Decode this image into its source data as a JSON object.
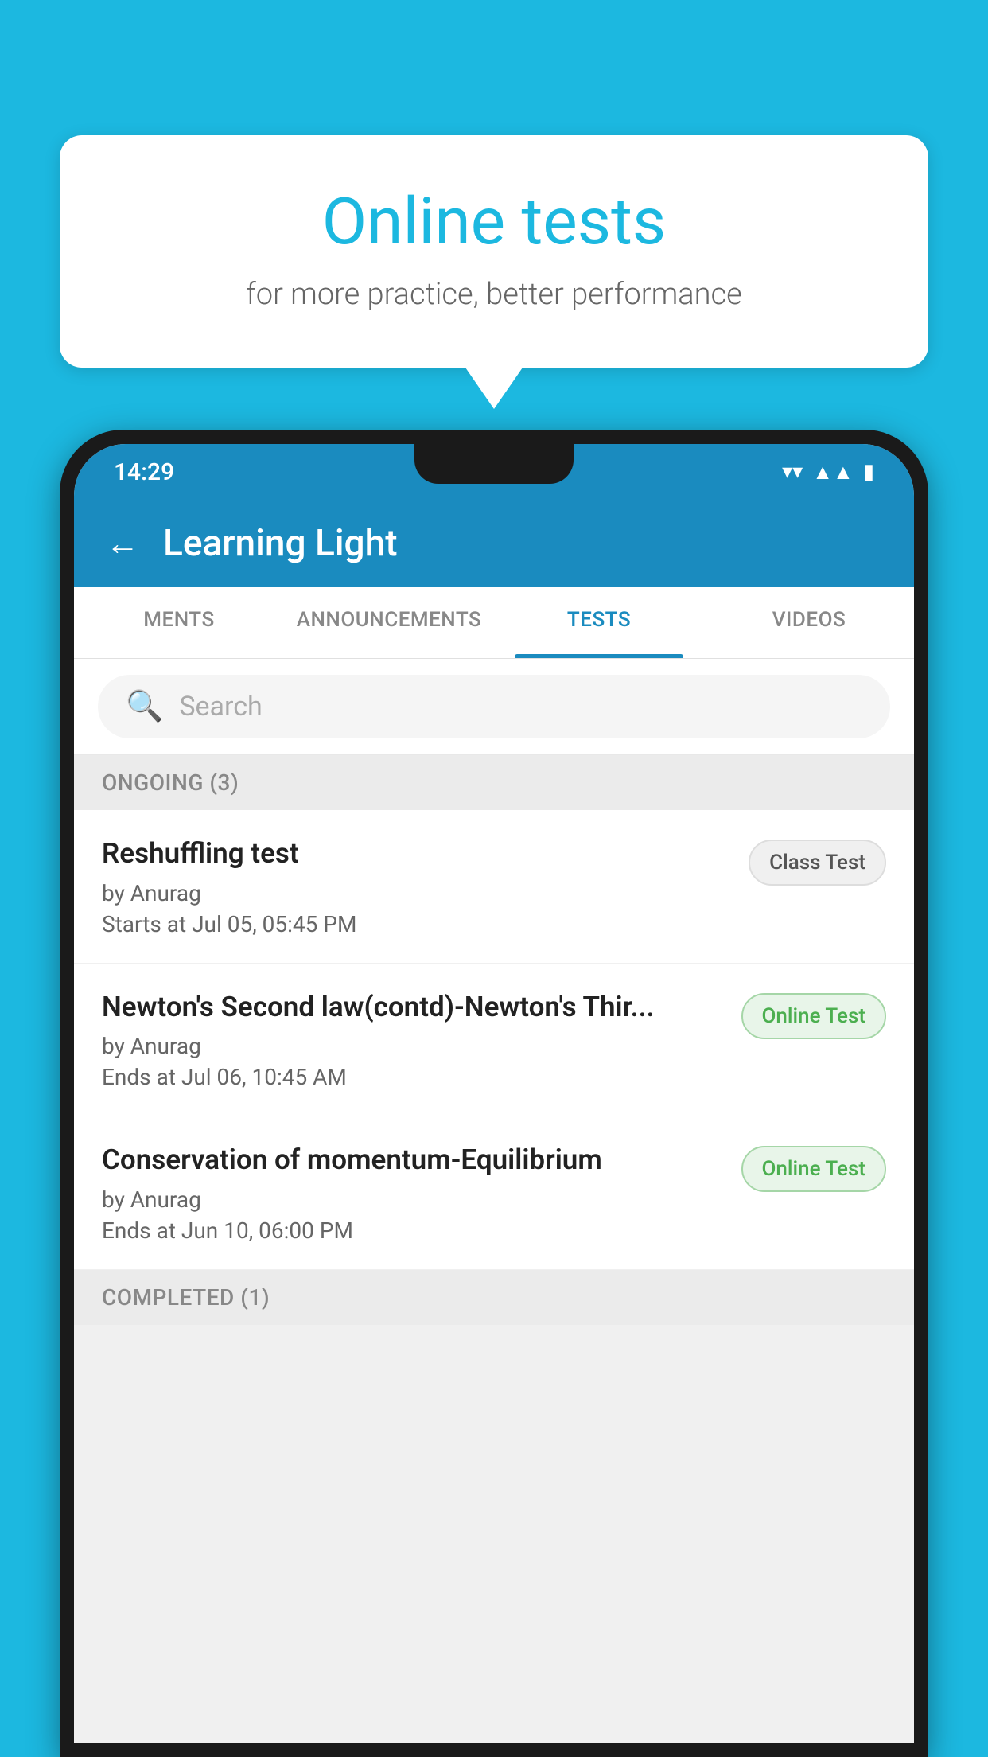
{
  "background_color": "#1cb8e0",
  "speech_bubble": {
    "title": "Online tests",
    "subtitle": "for more practice, better performance"
  },
  "phone": {
    "status_bar": {
      "time": "14:29",
      "wifi": "▾",
      "signal": "▲",
      "battery": "▮"
    },
    "app_bar": {
      "back_label": "←",
      "title": "Learning Light"
    },
    "tabs": [
      {
        "label": "MENTS",
        "active": false
      },
      {
        "label": "ANNOUNCEMENTS",
        "active": false
      },
      {
        "label": "TESTS",
        "active": true
      },
      {
        "label": "VIDEOS",
        "active": false
      }
    ],
    "search": {
      "placeholder": "Search"
    },
    "ongoing_section": {
      "title": "ONGOING (3)",
      "items": [
        {
          "name": "Reshuffling test",
          "author": "by Anurag",
          "time_label": "Starts at",
          "time": "Jul 05, 05:45 PM",
          "badge": "Class Test",
          "badge_type": "class"
        },
        {
          "name": "Newton's Second law(contd)-Newton's Thir...",
          "author": "by Anurag",
          "time_label": "Ends at",
          "time": "Jul 06, 10:45 AM",
          "badge": "Online Test",
          "badge_type": "online"
        },
        {
          "name": "Conservation of momentum-Equilibrium",
          "author": "by Anurag",
          "time_label": "Ends at",
          "time": "Jun 10, 06:00 PM",
          "badge": "Online Test",
          "badge_type": "online"
        }
      ]
    },
    "completed_section": {
      "title": "COMPLETED (1)"
    }
  }
}
